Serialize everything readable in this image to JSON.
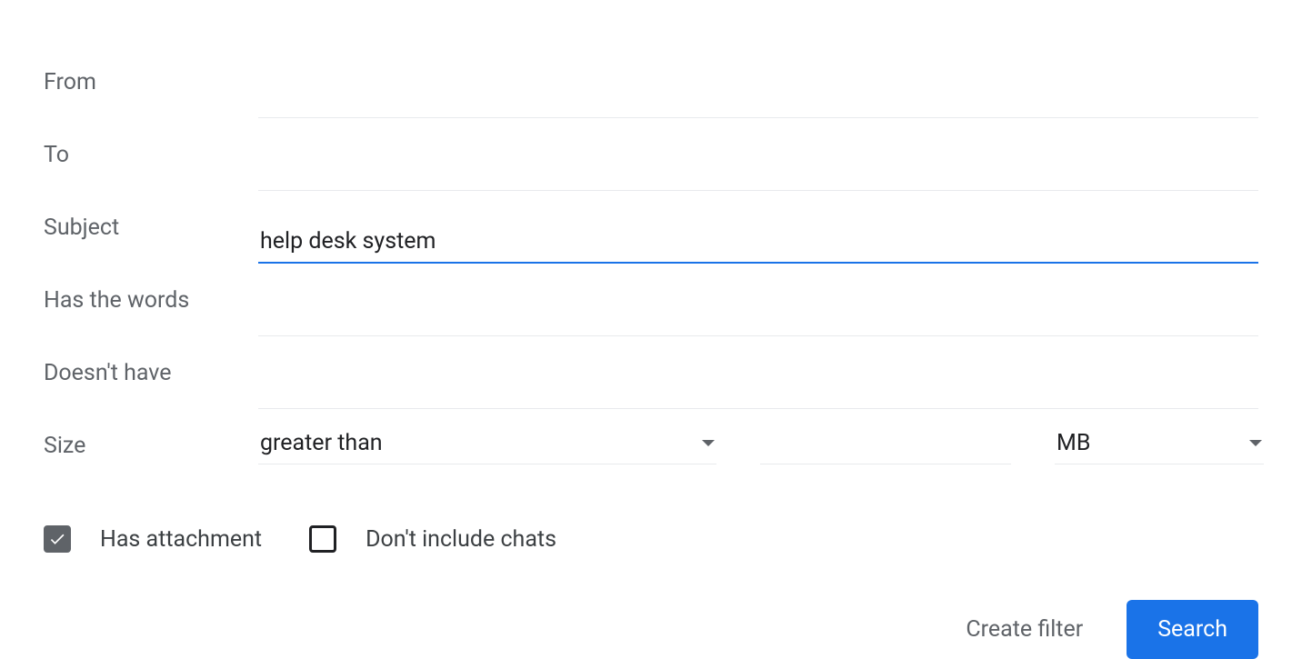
{
  "labels": {
    "from": "From",
    "to": "To",
    "subject": "Subject",
    "has_words": "Has the words",
    "doesnt_have": "Doesn't have",
    "size": "Size"
  },
  "values": {
    "from": "",
    "to": "",
    "subject": "help desk system",
    "has_words": "",
    "doesnt_have": "",
    "size_comparator": "greater than",
    "size_value": "",
    "size_unit": "MB"
  },
  "checkboxes": {
    "has_attachment": {
      "label": "Has attachment",
      "checked": true
    },
    "dont_include_chats": {
      "label": "Don't include chats",
      "checked": false
    }
  },
  "footer": {
    "create_filter": "Create filter",
    "search": "Search"
  }
}
